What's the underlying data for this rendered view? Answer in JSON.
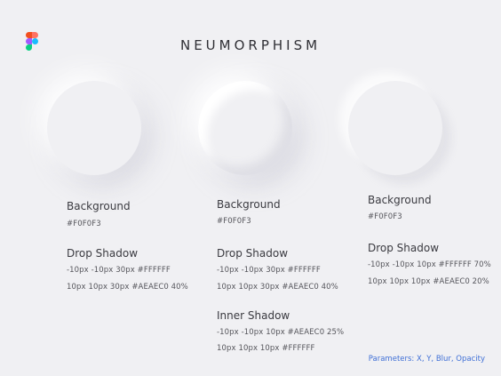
{
  "app": {
    "title": "NEUMORPHISM",
    "logo_icon": "figma-icon",
    "colors": {
      "background": "#F0F0F3",
      "light_shadow": "#FFFFFF",
      "dark_shadow": "#AEAEC0",
      "parameters_text": "#3f6fd6"
    }
  },
  "columns": [
    {
      "background_label": "Background",
      "background_value": "#F0F0F3",
      "drop_shadow_label": "Drop Shadow",
      "drop_shadow_values": [
        "-10px -10px 30px #FFFFFF",
        "10px 10px 30px #AEAEC0 40%"
      ]
    },
    {
      "background_label": "Background",
      "background_value": "#F0F0F3",
      "drop_shadow_label": "Drop Shadow",
      "drop_shadow_values": [
        "-10px -10px 30px #FFFFFF",
        "10px 10px 30px #AEAEC0 40%"
      ],
      "inner_shadow_label": "Inner Shadow",
      "inner_shadow_values": [
        "-10px -10px 10px #AEAEC0 25%",
        "10px 10px 10px #FFFFFF"
      ]
    },
    {
      "background_label": "Background",
      "background_value": "#F0F0F3",
      "drop_shadow_label": "Drop Shadow",
      "drop_shadow_values": [
        "-10px -10px 10px #FFFFFF 70%",
        "10px 10px 10px #AEAEC0 20%"
      ]
    }
  ],
  "footer": {
    "parameters": "Parameters: X, Y, Blur, Opacity"
  }
}
